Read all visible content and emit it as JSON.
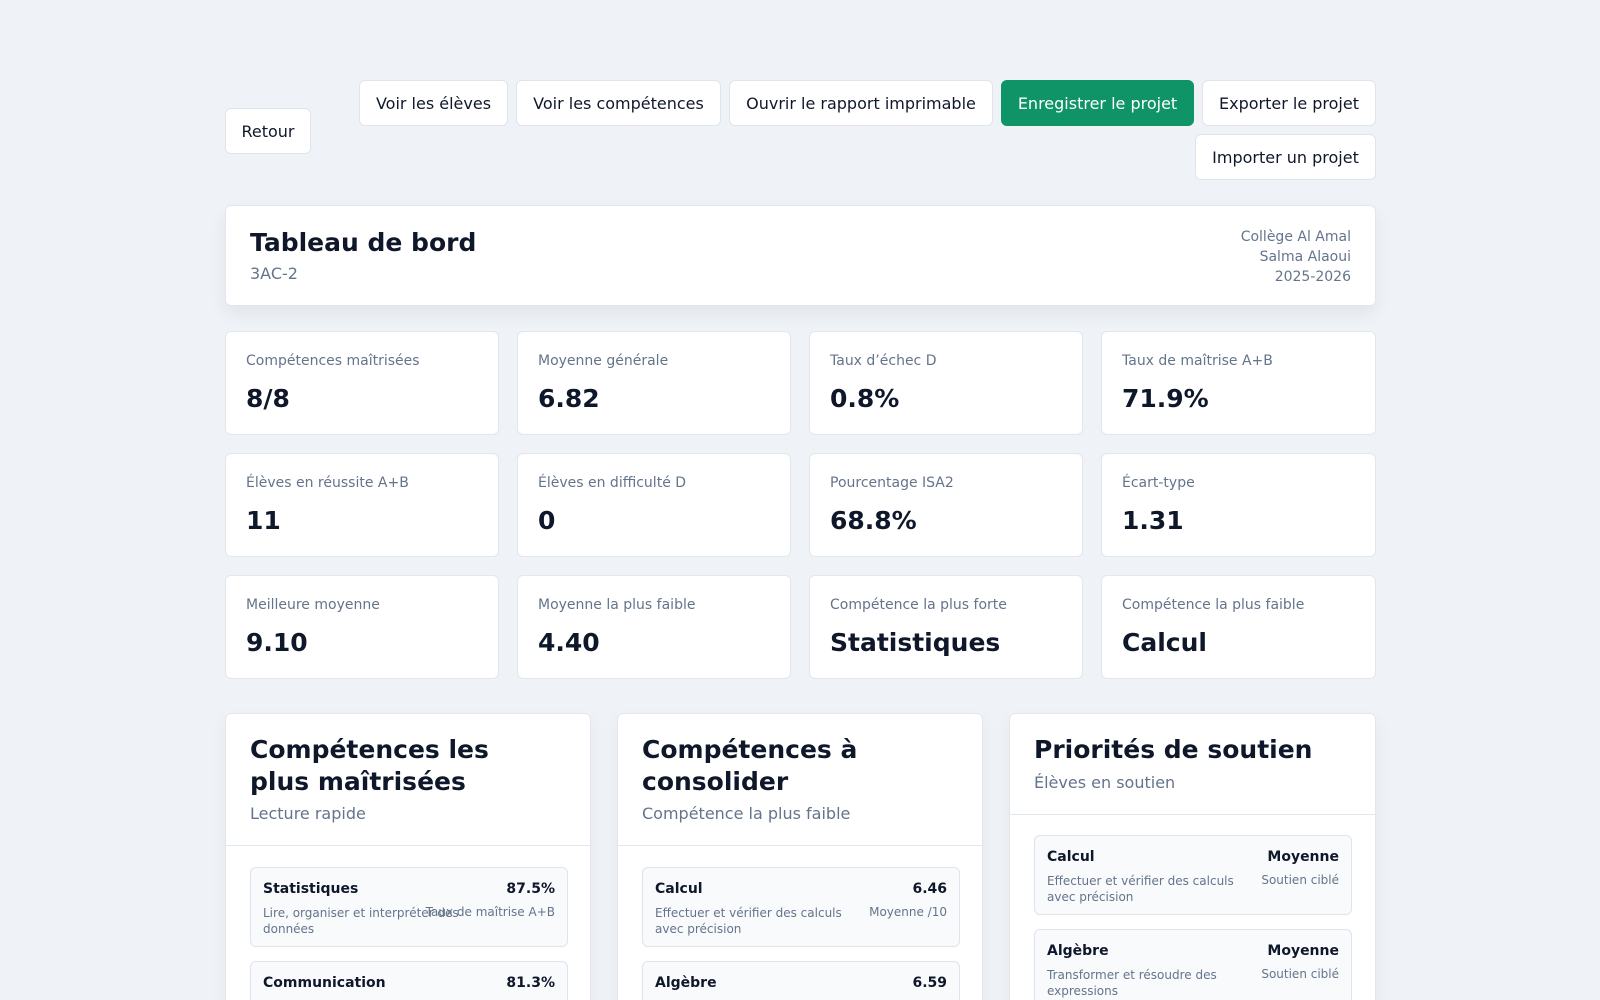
{
  "toolbar": {
    "back": "Retour",
    "view_students": "Voir les élèves",
    "view_skills": "Voir les compétences",
    "print_report": "Ouvrir le rapport imprimable",
    "save_project": "Enregistrer le projet",
    "export_project": "Exporter le projet",
    "import_project": "Importer un projet"
  },
  "colors": {
    "primary": "#0e9467",
    "background": "#eff3f8",
    "muted_text": "#64748b"
  },
  "header": {
    "title": "Tableau de bord",
    "class_name": "3AC-2",
    "school": "Collège Al Amal",
    "teacher": "Salma Alaoui",
    "year": "2025-2026"
  },
  "stats": [
    {
      "label": "Compétences maîtrisées",
      "value": "8/8"
    },
    {
      "label": "Moyenne générale",
      "value": "6.82"
    },
    {
      "label": "Taux d’échec D",
      "value": "0.8%"
    },
    {
      "label": "Taux de maîtrise A+B",
      "value": "71.9%"
    },
    {
      "label": "Élèves en réussite A+B",
      "value": "11"
    },
    {
      "label": "Élèves en difficulté D",
      "value": "0"
    },
    {
      "label": "Pourcentage ISA2",
      "value": "68.8%"
    },
    {
      "label": "Écart-type",
      "value": "1.31"
    },
    {
      "label": "Meilleure moyenne",
      "value": "9.10"
    },
    {
      "label": "Moyenne la plus faible",
      "value": "4.40"
    },
    {
      "label": "Compétence la plus forte",
      "value": "Statistiques"
    },
    {
      "label": "Compétence la plus faible",
      "value": "Calcul"
    }
  ],
  "panels": [
    {
      "title": "Compétences les plus maîtrisées",
      "subtitle": "Lecture rapide",
      "items": [
        {
          "name": "Statistiques",
          "value": "87.5%",
          "desc": "Lire, organiser et interpréter des données",
          "unit": "Taux de maîtrise A+B"
        },
        {
          "name": "Communication",
          "value": "81.3%",
          "desc": "",
          "unit": ""
        }
      ]
    },
    {
      "title": "Compétences à consolider",
      "subtitle": "Compétence la plus faible",
      "items": [
        {
          "name": "Calcul",
          "value": "6.46",
          "desc": "Effectuer et vérifier des calculs avec précision",
          "unit": "Moyenne /10"
        },
        {
          "name": "Algèbre",
          "value": "6.59",
          "desc": "",
          "unit": ""
        }
      ]
    },
    {
      "title": "Priorités de soutien",
      "subtitle": "Élèves en soutien",
      "items": [
        {
          "name": "Calcul",
          "value": "Moyenne",
          "desc": "Effectuer et vérifier des calculs avec précision",
          "unit": "Soutien ciblé"
        },
        {
          "name": "Algèbre",
          "value": "Moyenne",
          "desc": "Transformer et résoudre des expressions",
          "unit": "Soutien ciblé"
        }
      ]
    }
  ]
}
